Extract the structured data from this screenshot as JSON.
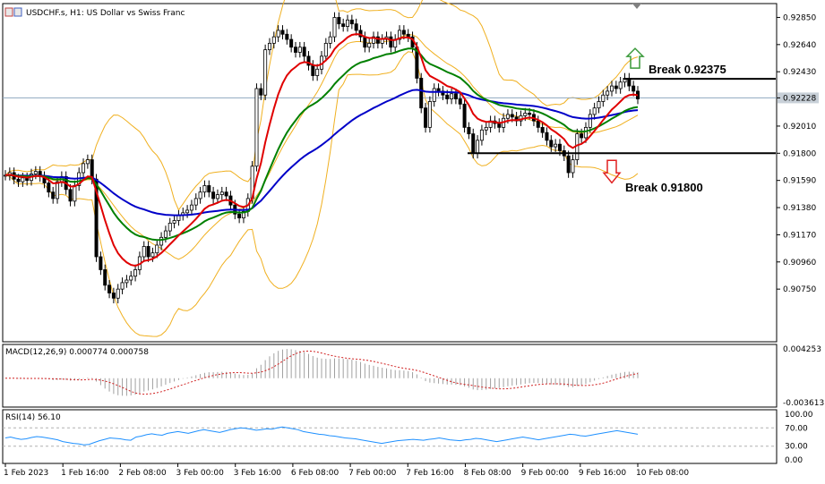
{
  "header": {
    "symbol_title": "USDCHF.s, H1:  US Dollar vs Swiss Franc"
  },
  "colors": {
    "candle": "#000000",
    "ma_fast": "#e00000",
    "ma_mid": "#008000",
    "ma_slow": "#0000c8",
    "bollinger": "#f0b020",
    "trendline": "#000000",
    "current_price_line": "#8fa8c0",
    "macd_hist": "#a0a0a0",
    "macd_signal": "#d02020",
    "rsi_line": "#1e90ff",
    "rsi_levels": "#b0b0b0",
    "arrow_up": "#3a9a3a",
    "arrow_down": "#e02020",
    "price_tag_bg": "#c8d0d8"
  },
  "chart_data": {
    "type": "line",
    "price_panel": {
      "ylim": [
        0.9035,
        0.9295
      ],
      "y_ticks": [
        "0.92850",
        "0.92640",
        "0.92430",
        "0.92228",
        "0.92010",
        "0.91800",
        "0.91590",
        "0.91380",
        "0.91170",
        "0.90960",
        "0.90750"
      ],
      "y_tick_values": [
        0.9285,
        0.9264,
        0.9243,
        0.92228,
        0.9201,
        0.918,
        0.9159,
        0.9138,
        0.9117,
        0.9096,
        0.9075
      ],
      "current_price": 0.92228,
      "current_price_label": "0.92228",
      "close_series": [
        0.9163,
        0.9165,
        0.916,
        0.9158,
        0.9161,
        0.9159,
        0.9164,
        0.9166,
        0.9162,
        0.9157,
        0.915,
        0.9145,
        0.9158,
        0.9162,
        0.9152,
        0.9143,
        0.9155,
        0.9165,
        0.9172,
        0.9175,
        0.916,
        0.91,
        0.909,
        0.9078,
        0.9072,
        0.9068,
        0.9075,
        0.908,
        0.9082,
        0.9085,
        0.909,
        0.91,
        0.9108,
        0.91,
        0.9103,
        0.9109,
        0.9115,
        0.912,
        0.9126,
        0.9128,
        0.9132,
        0.9134,
        0.9136,
        0.914,
        0.9145,
        0.915,
        0.9155,
        0.915,
        0.9145,
        0.9148,
        0.915,
        0.9147,
        0.914,
        0.9133,
        0.913,
        0.9135,
        0.9145,
        0.917,
        0.923,
        0.9225,
        0.926,
        0.9265,
        0.927,
        0.9275,
        0.9272,
        0.9268,
        0.9262,
        0.9258,
        0.9262,
        0.9255,
        0.9248,
        0.924,
        0.9245,
        0.9255,
        0.9265,
        0.927,
        0.9285,
        0.928,
        0.9278,
        0.9283,
        0.928,
        0.9275,
        0.927,
        0.9262,
        0.9265,
        0.927,
        0.9265,
        0.9268,
        0.927,
        0.9262,
        0.9268,
        0.9275,
        0.9272,
        0.927,
        0.9262,
        0.9238,
        0.9215,
        0.92,
        0.922,
        0.923,
        0.9228,
        0.9225,
        0.9222,
        0.9226,
        0.9222,
        0.9218,
        0.92,
        0.9195,
        0.918,
        0.919,
        0.9198,
        0.92,
        0.9205,
        0.9203,
        0.92,
        0.9207,
        0.921,
        0.9208,
        0.9205,
        0.9209,
        0.9211,
        0.921,
        0.9205,
        0.92,
        0.9196,
        0.919,
        0.9185,
        0.9187,
        0.9182,
        0.9178,
        0.9165,
        0.9175,
        0.9195,
        0.9192,
        0.92,
        0.921,
        0.9215,
        0.922,
        0.9225,
        0.9228,
        0.9232,
        0.923,
        0.9235,
        0.9238,
        0.9232,
        0.9228,
        0.9222
      ]
    },
    "x_ticks": [
      "1 Feb 2023",
      "1 Feb 16:00",
      "2 Feb 08:00",
      "3 Feb 00:00",
      "3 Feb 16:00",
      "6 Feb 08:00",
      "7 Feb 00:00",
      "7 Feb 16:00",
      "8 Feb 08:00",
      "9 Feb 00:00",
      "9 Feb 16:00",
      "10 Feb 08:00"
    ],
    "annotations": [
      {
        "text": "Break 0.92375",
        "level": 0.92375,
        "direction": "up"
      },
      {
        "text": "Break 0.91800",
        "level": 0.918,
        "direction": "down"
      }
    ],
    "macd": {
      "label": "MACD(12,26,9) 0.000774 0.000758",
      "y_ticks": [
        "0.004253",
        "-0.003613"
      ],
      "ylim": [
        -0.003613,
        0.004253
      ]
    },
    "rsi": {
      "label": "RSI(14) 56.10",
      "y_ticks": [
        "100.00",
        "70.00",
        "30.00",
        "0.00"
      ],
      "levels": [
        70,
        30
      ],
      "ylim": [
        0,
        100
      ],
      "series": [
        48,
        50,
        47,
        45,
        46,
        49,
        51,
        50,
        48,
        46,
        44,
        40,
        38,
        36,
        35,
        33,
        34,
        38,
        42,
        45,
        48,
        47,
        46,
        44,
        43,
        50,
        52,
        55,
        57,
        55,
        54,
        58,
        60,
        62,
        60,
        58,
        61,
        64,
        66,
        64,
        62,
        60,
        63,
        66,
        68,
        70,
        69,
        67,
        65,
        66,
        68,
        67,
        70,
        72,
        70,
        68,
        66,
        62,
        60,
        58,
        56,
        55,
        53,
        52,
        50,
        48,
        47,
        46,
        44,
        42,
        40,
        38,
        36,
        38,
        40,
        42,
        43,
        44,
        45,
        44,
        43,
        45,
        46,
        48,
        46,
        44,
        43,
        42,
        44,
        45,
        47,
        46,
        44,
        42,
        40,
        42,
        44,
        46,
        48,
        50,
        48,
        46,
        44,
        46,
        48,
        50,
        52,
        54,
        56,
        55,
        53,
        52,
        54,
        56,
        58,
        60,
        62,
        64,
        62,
        60,
        58,
        56
      ]
    }
  }
}
